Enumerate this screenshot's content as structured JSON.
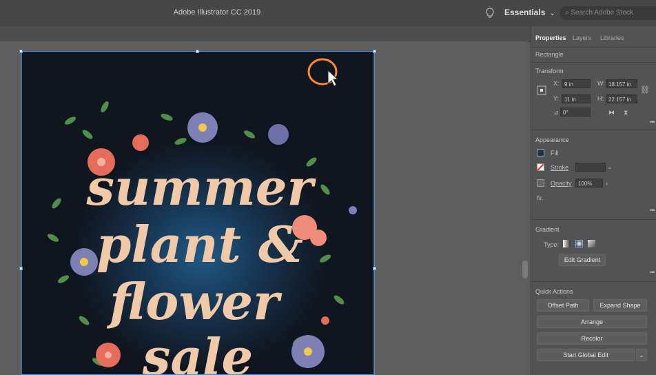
{
  "title": {
    "app": "Adobe Illustrator CC 2019"
  },
  "header": {
    "workspace": "Essentials",
    "search_placeholder": "Search Adobe Stock"
  },
  "panel": {
    "tabs": [
      "Properties",
      "Layers",
      "Libraries"
    ],
    "object_type": "Rectangle",
    "transform": {
      "label": "Transform",
      "x_label": "X:",
      "x": "9 in",
      "y_label": "Y:",
      "y": "11 in",
      "w_label": "W:",
      "w": "18.157 in",
      "h_label": "H:",
      "h": "22.157 in",
      "angle": "0°"
    },
    "appearance": {
      "label": "Appearance",
      "fill": "Fill",
      "stroke": "Stroke",
      "opacity_label": "Opacity",
      "opacity": "100%"
    },
    "gradient": {
      "label": "Gradient",
      "type_label": "Type:",
      "edit_button": "Edit Gradient"
    },
    "quick_actions": {
      "label": "Quick Actions",
      "offset_path": "Offset Path",
      "expand_shape": "Expand Shape",
      "arrange": "Arrange",
      "recolor": "Recolor",
      "start_global_edit": "Start Global Edit"
    }
  },
  "artwork": {
    "lines": [
      "summer",
      "plant &",
      "flower",
      "sale"
    ]
  },
  "colors": {
    "artboard_bg": "#10161f",
    "lettering": "#f0c9a8",
    "selection": "#4a8fdf",
    "cursor_ring": "#ff8a2a"
  }
}
